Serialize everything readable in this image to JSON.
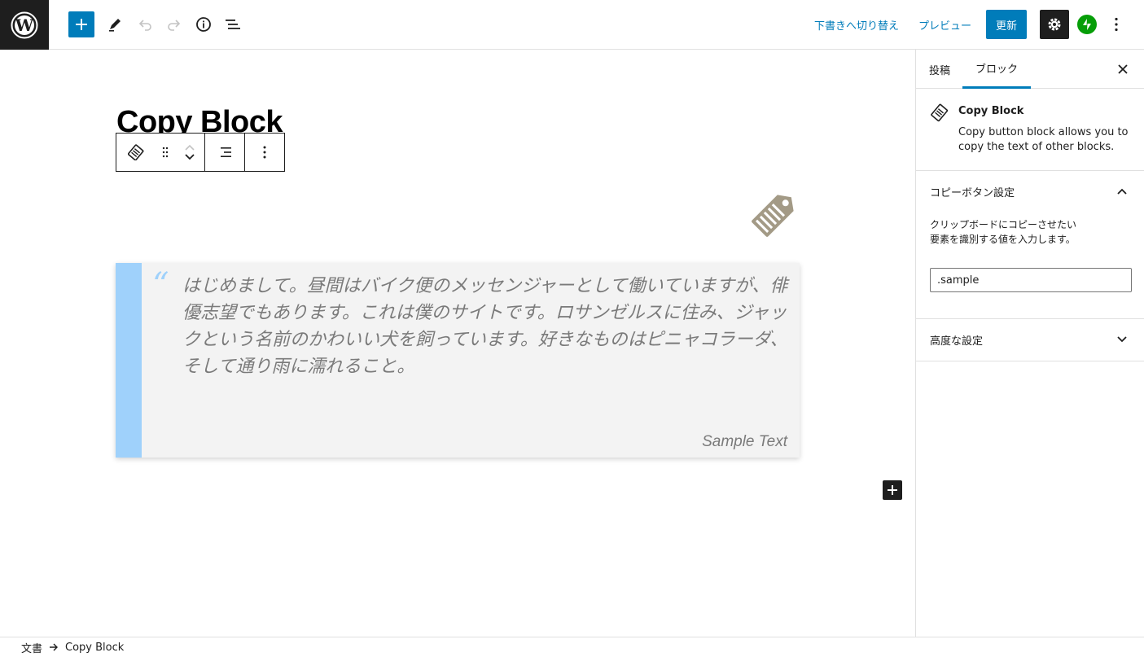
{
  "header": {
    "add_block_label": "+",
    "switch_to_draft": "下書きへ切り替え",
    "preview": "プレビュー",
    "update": "更新",
    "colors": {
      "accent": "#007cba",
      "dark": "#1e1e1e",
      "jetpack": "#069e08"
    }
  },
  "editor": {
    "post_title": "Copy Block",
    "quote": {
      "mark": "“",
      "text": "はじめまして。昼間はバイク便のメッセンジャーとして働いていますが、俳優志望でもあります。これは僕のサイトです。ロサンゼルスに住み、ジャックという名前のかわいい犬を飼っています。好きなものはピニャコラーダ、そして通り雨に濡れること。",
      "citation": "Sample Text",
      "bar_color": "#9fd1fb",
      "background": "#f3f3f3"
    },
    "icons": {
      "copy_tag": "tag-icon",
      "tag_color": "#a39a86"
    }
  },
  "sidebar": {
    "tabs": [
      {
        "label": "投稿"
      },
      {
        "label": "ブロック"
      }
    ],
    "block_card": {
      "title": "Copy Block",
      "description": "Copy button block allows you to copy the text of other blocks."
    },
    "copy_settings": {
      "title": "コピーボタン設定",
      "help": "クリップボードにコピーさせたい要素を識別する値を入力します。",
      "input_value": ".sample"
    },
    "advanced": {
      "title": "高度な設定"
    }
  },
  "footer": {
    "breadcrumb": [
      "文書",
      "Copy Block"
    ]
  }
}
